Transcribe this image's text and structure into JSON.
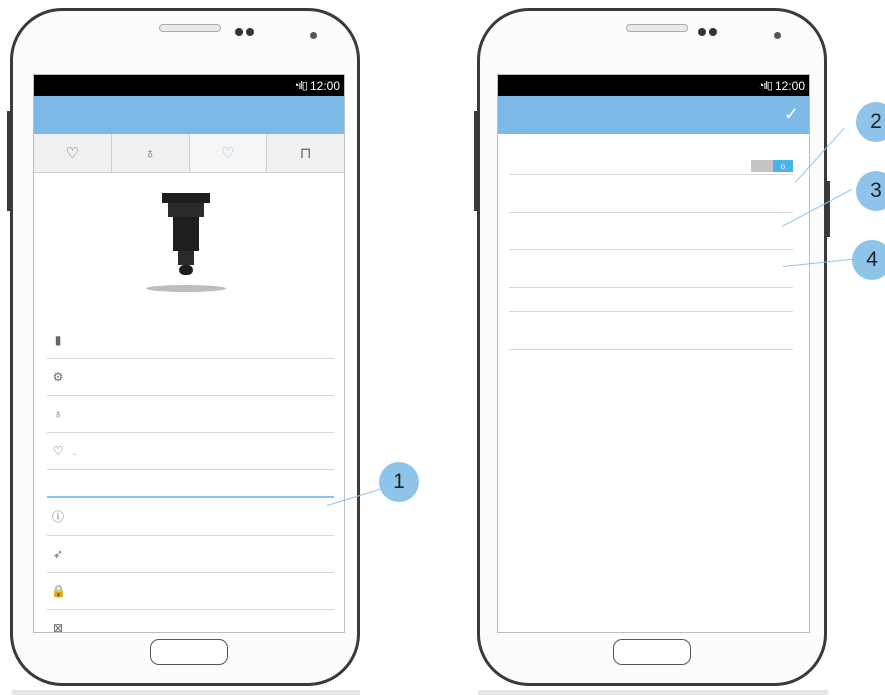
{
  "status_bar": {
    "time": "12:00",
    "signal_icons": "wifi-signal-battery"
  },
  "left_screen": {
    "tabs": [
      {
        "icon": "bulb-icon",
        "glyph": "♡",
        "active": false
      },
      {
        "icon": "bulb-outline-icon",
        "glyph": "♁",
        "active": false
      },
      {
        "icon": "bulb-blue-icon",
        "glyph": "♡",
        "active": true
      },
      {
        "icon": "book-icon",
        "glyph": "⊓",
        "active": false
      }
    ],
    "rows_top": [
      {
        "icon": "battery-icon",
        "glyph": "▮"
      },
      {
        "icon": "gear-icon",
        "glyph": "⚙"
      },
      {
        "icon": "bulb-outline-icon",
        "glyph": "♁"
      },
      {
        "icon": "bulb-icon",
        "glyph": "♡",
        "suffix": "."
      }
    ],
    "rows_bottom": [
      {
        "icon": "info-icon",
        "glyph": "ⓘ"
      },
      {
        "icon": "navigation-icon",
        "glyph": "➶"
      },
      {
        "icon": "lock-icon",
        "glyph": "🔒"
      },
      {
        "icon": "close-box-icon",
        "glyph": "⊠"
      }
    ]
  },
  "right_screen": {
    "confirm_icon": "✓",
    "toggle_label": "o"
  },
  "callouts": [
    "1",
    "2",
    "3",
    "4"
  ],
  "colors": {
    "accent": "#7db9e6",
    "callout": "#8ec4ea",
    "toggle_on": "#4ab3e8"
  }
}
